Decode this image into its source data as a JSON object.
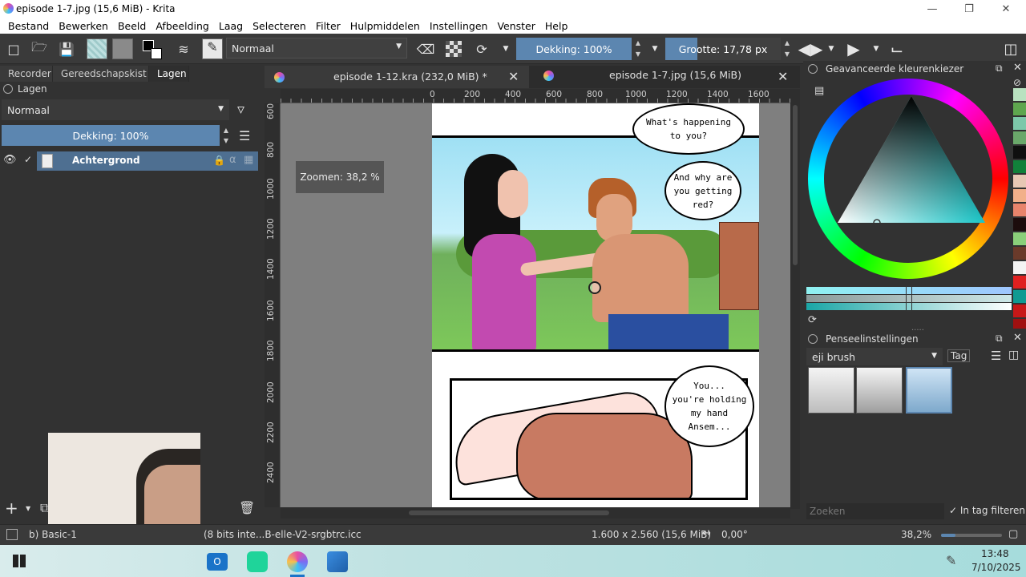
{
  "window": {
    "title": "episode 1-7.jpg (15,6 MiB) - Krita"
  },
  "menu": [
    "Bestand",
    "Bewerken",
    "Beeld",
    "Afbeelding",
    "Laag",
    "Selecteren",
    "Filter",
    "Hulpmiddelen",
    "Instellingen",
    "Venster",
    "Help"
  ],
  "toolbar": {
    "blend_mode": "Normaal",
    "opacity_label": "Dekking: 100%",
    "size_label": "Grootte: 17,78 px"
  },
  "left_tabs": [
    "Recorder",
    "Gereedschapskist",
    "Lagen"
  ],
  "layers": {
    "panel_title": "Lagen",
    "blend_mode": "Normaal",
    "opacity_label": "Dekking:  100%",
    "layer_name": "Achtergrond"
  },
  "documents": [
    {
      "label": "episode 1-12.kra (232,0 MiB) *"
    },
    {
      "label": "episode 1-7.jpg (15,6 MiB)"
    }
  ],
  "ruler_h": [
    "0",
    "200",
    "400",
    "600",
    "800",
    "1000",
    "1200",
    "1400",
    "1600"
  ],
  "ruler_v": [
    "600",
    "800",
    "1000",
    "1200",
    "1400",
    "1600",
    "1800",
    "2000",
    "2200",
    "2400"
  ],
  "zoom_tooltip": "Zoomen: 38,2 %",
  "comic": {
    "bubble1": "What's happening\nto you?",
    "bubble2": "And why are\nyou getting\nred?",
    "bubble3": "You...\nyou're holding\nmy hand\nAnsem..."
  },
  "color_panel": {
    "title": "Geavanceerde kleurenkiezer"
  },
  "brush_panel": {
    "title": "Penseelinstellingen",
    "preset": "eji brush",
    "tag_label": "Tag",
    "search_placeholder": "Zoeken",
    "filter_label": "In tag filteren"
  },
  "status": {
    "brush": "b) Basic-1",
    "profile": "(8 bits inte...B-elle-V2-srgbtrc.icc",
    "dimensions": "1.600 x 2.560 (15,6 MiB)",
    "rotation": "0,00°",
    "zoom": "38,2%"
  },
  "clock": {
    "time": "13:48",
    "date": "7/10/2025"
  },
  "colors": {
    "accent": "#5c86b0",
    "panel": "#323232",
    "layer_selected": "#4e6f91"
  }
}
